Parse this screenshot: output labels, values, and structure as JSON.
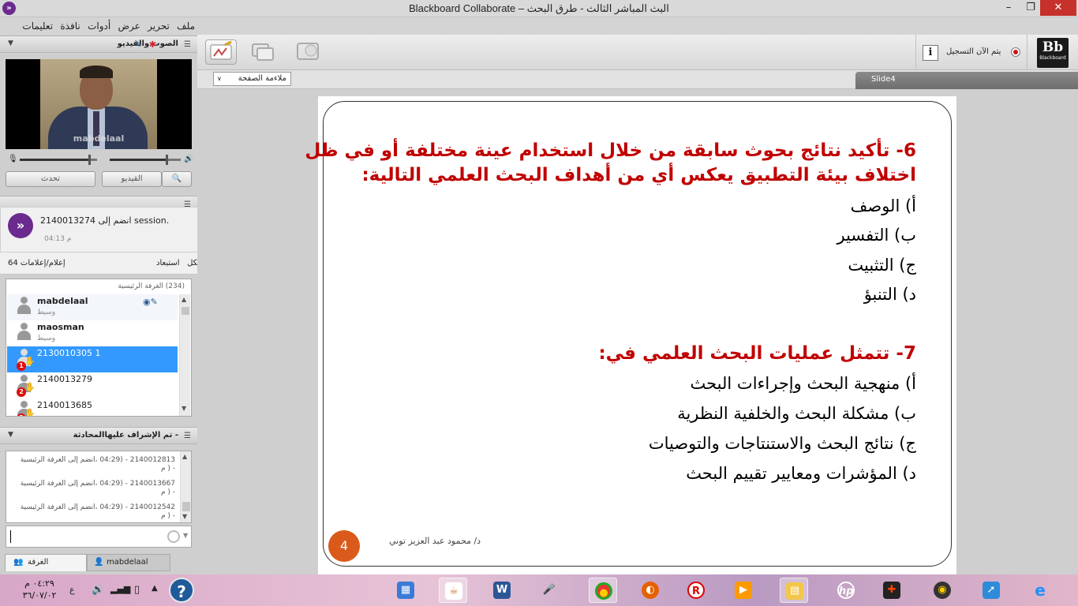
{
  "window": {
    "title": "Blackboard Collaborate – البث المباشر الثالث - طرق البحث",
    "min_glyph": "–",
    "max_glyph": "❐",
    "close_glyph": "✕",
    "app_icon": "»"
  },
  "menu": [
    "ملف",
    "تحرير",
    "عرض",
    "أدوات",
    "نافذة",
    "تعليمات"
  ],
  "audio_video": {
    "title": "الصوت والقيديو",
    "presenter_name": "mabdelaal",
    "talk_label": "تحدث",
    "video_label": "القيديو",
    "speaker_level": 0.8,
    "mic_level": 0.9
  },
  "notification": {
    "message": "2140013274 انضم إلى session.",
    "time": "04:13 م",
    "icon": "»"
  },
  "hands": {
    "count_label": "64 إعلام/إعلامات",
    "clear_label": "استبعاد",
    "clear_all_label": "استبعاد الكل"
  },
  "participants": {
    "room_label": "(234) الغرفة الرئيسية",
    "rows": [
      {
        "name": "mabdelaal",
        "role": "وسيط"
      },
      {
        "name": "maosman",
        "role": "وسيط"
      },
      {
        "name": "2130010305 1",
        "badge": "1"
      },
      {
        "name": "2140013279",
        "badge": "2"
      },
      {
        "name": "2140013685",
        "badge": "3"
      }
    ]
  },
  "chat": {
    "title": "- تم الإشراف عليهاالمحادثة",
    "messages": [
      {
        "line1": "2140012813 - (04:29 ،انضم إلى الغرفة الرئيسية",
        "line2": "- ( م"
      },
      {
        "line1": "2140013667 - (04:29 ،انضم إلى الغرفة الرئيسية",
        "line2": "- ( م"
      },
      {
        "line1": "2140012542 - (04:29 ،انضم إلى الغرفة الرئيسية",
        "line2": "- ( م"
      }
    ],
    "tab_room": "الغرفة",
    "tab_user": "mabdelaal"
  },
  "toolbar": {
    "recording_label": "يتم الآن التسجيل",
    "info_glyph": "i",
    "logo_text": "Bb",
    "logo_sub": "Blackboard",
    "fit_page_label": "ملاءمة الصفحة",
    "slide_tab": "Slide4"
  },
  "slide": {
    "q6_line1": "6- تأكيد نتائج بحوث سابقة من خلال استخدام عينة مختلفة أو في ظل",
    "q6_line2": "اختلاف بيئة التطبيق يعكس أي من أهداف البحث العلمي التالية:",
    "q6_options": [
      "أ) الوصف",
      "ب) التفسير",
      "ج) التثبيت",
      "د) التنبؤ"
    ],
    "q7_title": "7- تتمثل عمليات البحث العلمي في:",
    "q7_options": [
      "أ) منهجية البحث وإجراءات البحث",
      "ب) مشكلة البحث والخلفية النظرية",
      "ج) نتائج البحث والاستنتاجات والتوصيات",
      "د) المؤشرات ومعايير تقييم البحث"
    ],
    "number": "4",
    "author": "د/ محمود عبد العزيز توني"
  },
  "taskbar": {
    "time": "٠٤:٢٩ م",
    "date": "٣٦/٠٧/٠٢",
    "lang": "ع"
  }
}
